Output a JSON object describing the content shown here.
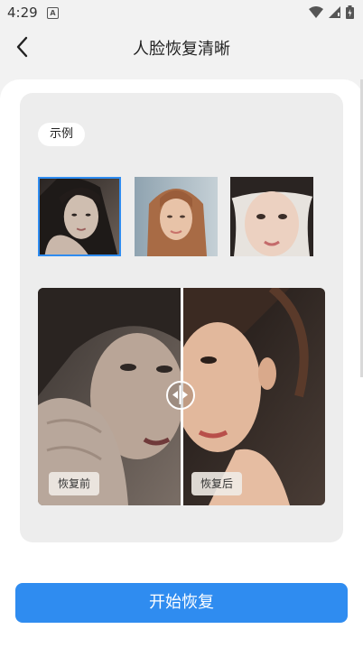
{
  "status_bar": {
    "time": "4:29",
    "notification_badge": "A"
  },
  "header": {
    "title": "人脸恢复清晰",
    "back_icon": "chevron-left-icon"
  },
  "examples": {
    "tag_label": "示例",
    "thumbnails": [
      {
        "name": "example-photo-1",
        "selected": true
      },
      {
        "name": "example-photo-2",
        "selected": false
      },
      {
        "name": "example-photo-3",
        "selected": false
      }
    ]
  },
  "comparison": {
    "before_label": "恢复前",
    "after_label": "恢复后",
    "handle_icon": "left-right-arrows-icon"
  },
  "action": {
    "start_label": "开始恢复"
  },
  "colors": {
    "accent": "#2f8cf0",
    "card_bg": "#ededed",
    "page_bg": "#f2f2f2"
  }
}
